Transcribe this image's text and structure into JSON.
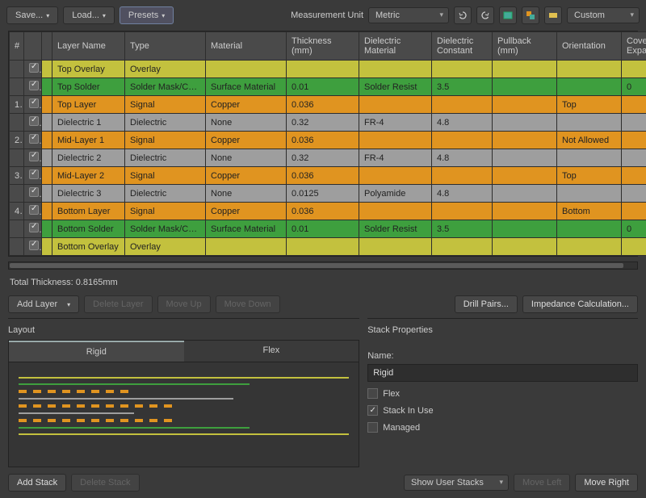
{
  "toolbar": {
    "save": "Save...",
    "load": "Load...",
    "presets": "Presets",
    "unit_label": "Measurement Unit",
    "unit_value": "Metric",
    "right_select": "Custom"
  },
  "columns": [
    "#",
    "",
    "",
    "Layer Name",
    "Type",
    "Material",
    "Thickness (mm)",
    "Dielectric Material",
    "Dielectric Constant",
    "Pullback (mm)",
    "Orientation",
    "Coverlay Expansion"
  ],
  "rows": [
    {
      "cls": "r-olive",
      "num": "",
      "name": "Top Overlay",
      "type": "Overlay",
      "mat": "",
      "thk": "",
      "dmat": "",
      "dc": "",
      "pb": "",
      "ori": "",
      "cov": ""
    },
    {
      "cls": "r-green",
      "num": "",
      "name": "Top Solder",
      "type": "Solder Mask/Co...",
      "mat": "Surface Material",
      "thk": "0.01",
      "dmat": "Solder Resist",
      "dc": "3.5",
      "pb": "",
      "ori": "",
      "cov": "0"
    },
    {
      "cls": "r-orange",
      "num": "1",
      "name": "Top Layer",
      "type": "Signal",
      "mat": "Copper",
      "thk": "0.036",
      "dmat": "",
      "dc": "",
      "pb": "",
      "ori": "Top",
      "cov": ""
    },
    {
      "cls": "r-gray",
      "num": "",
      "name": "Dielectric 1",
      "type": "Dielectric",
      "mat": "None",
      "thk": "0.32",
      "dmat": "FR-4",
      "dc": "4.8",
      "pb": "",
      "ori": "",
      "cov": ""
    },
    {
      "cls": "r-orange",
      "num": "2",
      "name": "Mid-Layer 1",
      "type": "Signal",
      "mat": "Copper",
      "thk": "0.036",
      "dmat": "",
      "dc": "",
      "pb": "",
      "ori": "Not Allowed",
      "cov": ""
    },
    {
      "cls": "r-gray",
      "num": "",
      "name": "Dielectric 2",
      "type": "Dielectric",
      "mat": "None",
      "thk": "0.32",
      "dmat": "FR-4",
      "dc": "4.8",
      "pb": "",
      "ori": "",
      "cov": ""
    },
    {
      "cls": "r-orange",
      "num": "3",
      "name": "Mid-Layer 2",
      "type": "Signal",
      "mat": "Copper",
      "thk": "0.036",
      "dmat": "",
      "dc": "",
      "pb": "",
      "ori": "Top",
      "cov": ""
    },
    {
      "cls": "r-gray",
      "num": "",
      "name": "Dielectric 3",
      "type": "Dielectric",
      "mat": "None",
      "thk": "0.0125",
      "dmat": "Polyamide",
      "dc": "4.8",
      "pb": "",
      "ori": "",
      "cov": ""
    },
    {
      "cls": "r-orange",
      "num": "4",
      "name": "Bottom Layer",
      "type": "Signal",
      "mat": "Copper",
      "thk": "0.036",
      "dmat": "",
      "dc": "",
      "pb": "",
      "ori": "Bottom",
      "cov": ""
    },
    {
      "cls": "r-green",
      "num": "",
      "name": "Bottom Solder",
      "type": "Solder Mask/Co...",
      "mat": "Surface Material",
      "thk": "0.01",
      "dmat": "Solder Resist",
      "dc": "3.5",
      "pb": "",
      "ori": "",
      "cov": "0"
    },
    {
      "cls": "r-olive",
      "num": "",
      "name": "Bottom Overlay",
      "type": "Overlay",
      "mat": "",
      "thk": "",
      "dmat": "",
      "dc": "",
      "pb": "",
      "ori": "",
      "cov": ""
    }
  ],
  "total": "Total Thickness: 0.8165mm",
  "actions": {
    "add_layer": "Add Layer",
    "delete_layer": "Delete Layer",
    "move_up": "Move Up",
    "move_down": "Move Down",
    "drill": "Drill Pairs...",
    "imp": "Impedance Calculation..."
  },
  "layout": {
    "title": "Layout",
    "tabs": [
      "Rigid",
      "Flex"
    ]
  },
  "props": {
    "title": "Stack Properties",
    "name_label": "Name:",
    "name_value": "Rigid",
    "flex": "Flex",
    "inuse": "Stack In Use",
    "managed": "Managed"
  },
  "footer": {
    "add_stack": "Add Stack",
    "delete_stack": "Delete Stack",
    "show": "Show User Stacks",
    "move_left": "Move Left",
    "move_right": "Move Right"
  }
}
